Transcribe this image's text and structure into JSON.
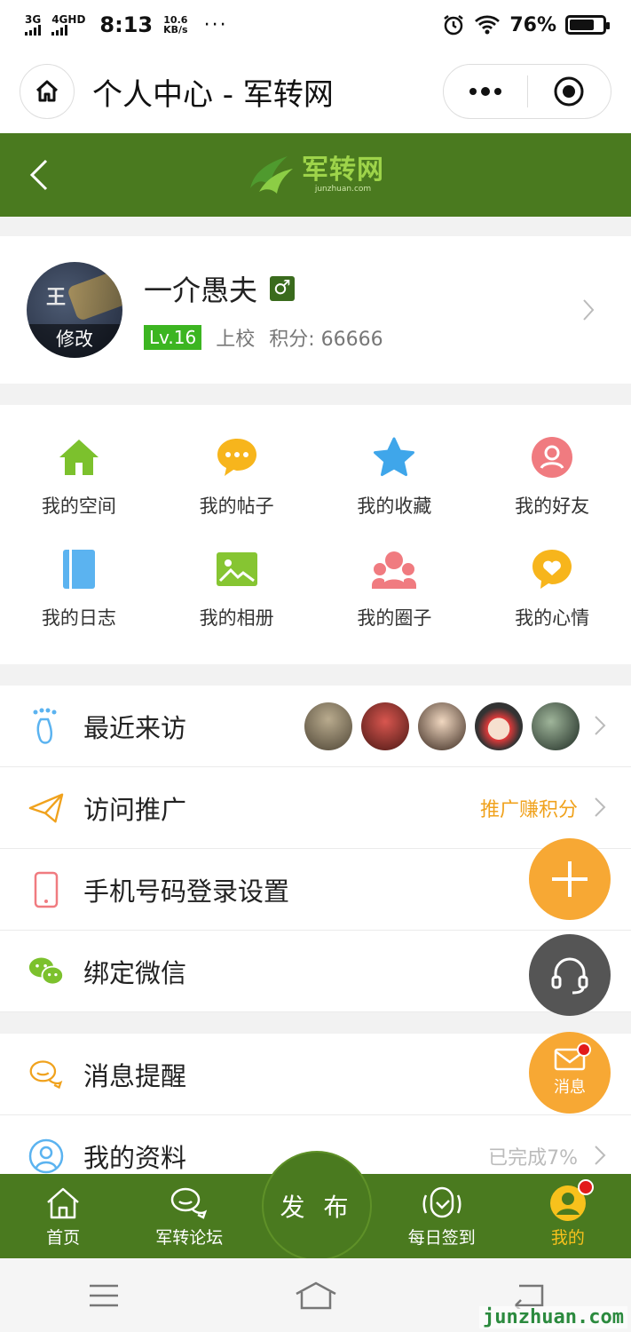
{
  "status_bar": {
    "network1": "3G",
    "network2": "4GHD",
    "time": "8:13",
    "speed_value": "10.6",
    "speed_unit": "KB/s",
    "more": "···",
    "battery": "76%",
    "battery_level": 0.76
  },
  "miniprogram": {
    "title": "个人中心 - 军转网"
  },
  "site_header": {
    "logo_text": "军转网",
    "logo_sub": "junzhuan.com",
    "brand_color": "#4a7a1f"
  },
  "profile": {
    "name": "一介愚夫",
    "gender_symbol": "♂",
    "avatar_edit": "修改",
    "level": "Lv.16",
    "rank": "上校",
    "points": "积分: 66666"
  },
  "grid": [
    {
      "label": "我的空间",
      "icon": "home-icon",
      "color": "#7cc12d"
    },
    {
      "label": "我的帖子",
      "icon": "chat-bubble-icon",
      "color": "#f7b51c"
    },
    {
      "label": "我的收藏",
      "icon": "star-icon",
      "color": "#3fa6ea"
    },
    {
      "label": "我的好友",
      "icon": "friend-icon",
      "color": "#f07b80"
    },
    {
      "label": "我的日志",
      "icon": "notebook-icon",
      "color": "#5bb3f0"
    },
    {
      "label": "我的相册",
      "icon": "photo-album-icon",
      "color": "#86c532"
    },
    {
      "label": "我的圈子",
      "icon": "group-icon",
      "color": "#f07b80"
    },
    {
      "label": "我的心情",
      "icon": "heart-bubble-icon",
      "color": "#f7b51c"
    }
  ],
  "list1": [
    {
      "label": "最近来访",
      "icon": "footprint-icon",
      "right": ""
    },
    {
      "label": "访问推广",
      "icon": "paper-plane-icon",
      "right": "推广赚积分",
      "right_color": "#f0a21d"
    },
    {
      "label": "手机号码登录设置",
      "icon": "phone-icon",
      "right": ""
    },
    {
      "label": "绑定微信",
      "icon": "wechat-icon",
      "right": ""
    }
  ],
  "list2": [
    {
      "label": "消息提醒",
      "icon": "message-bubble-icon",
      "right": ""
    },
    {
      "label": "我的资料",
      "icon": "profile-icon",
      "right": "已完成7%"
    }
  ],
  "fab": {
    "message_label": "消息"
  },
  "tabbar": {
    "home": "首页",
    "forum": "军转论坛",
    "publish": "发 布",
    "checkin": "每日签到",
    "mine": "我的"
  },
  "watermark": "junzhuan.com"
}
